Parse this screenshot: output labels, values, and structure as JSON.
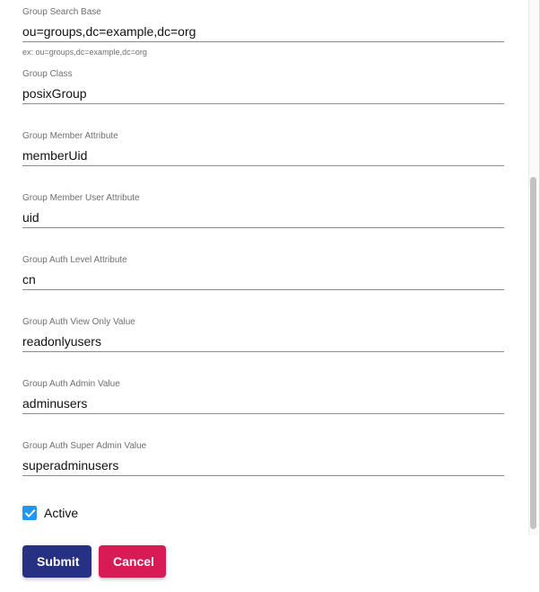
{
  "colors": {
    "submit_button": "#273183",
    "cancel_button": "#d81b55",
    "checkbox": "#2196f3",
    "label_text": "#6f6f6f"
  },
  "fields": [
    {
      "label": "Group Search Base",
      "value": "ou=groups,dc=example,dc=org",
      "helper": "ex: ou=groups,dc=example,dc=org"
    },
    {
      "label": "Group Class",
      "value": "posixGroup"
    },
    {
      "label": "Group Member Attribute",
      "value": "memberUid"
    },
    {
      "label": "Group Member User Attribute",
      "value": "uid"
    },
    {
      "label": "Group Auth Level Attribute",
      "value": "cn"
    },
    {
      "label": "Group Auth View Only Value",
      "value": "readonlyusers"
    },
    {
      "label": "Group Auth Admin Value",
      "value": "adminusers"
    },
    {
      "label": "Group Auth Super Admin Value",
      "value": "superadminusers"
    }
  ],
  "active": {
    "label": "Active",
    "checked": true,
    "icon": "checkmark-icon"
  },
  "actions": {
    "submit_label": "Submit",
    "cancel_label": "Cancel"
  }
}
